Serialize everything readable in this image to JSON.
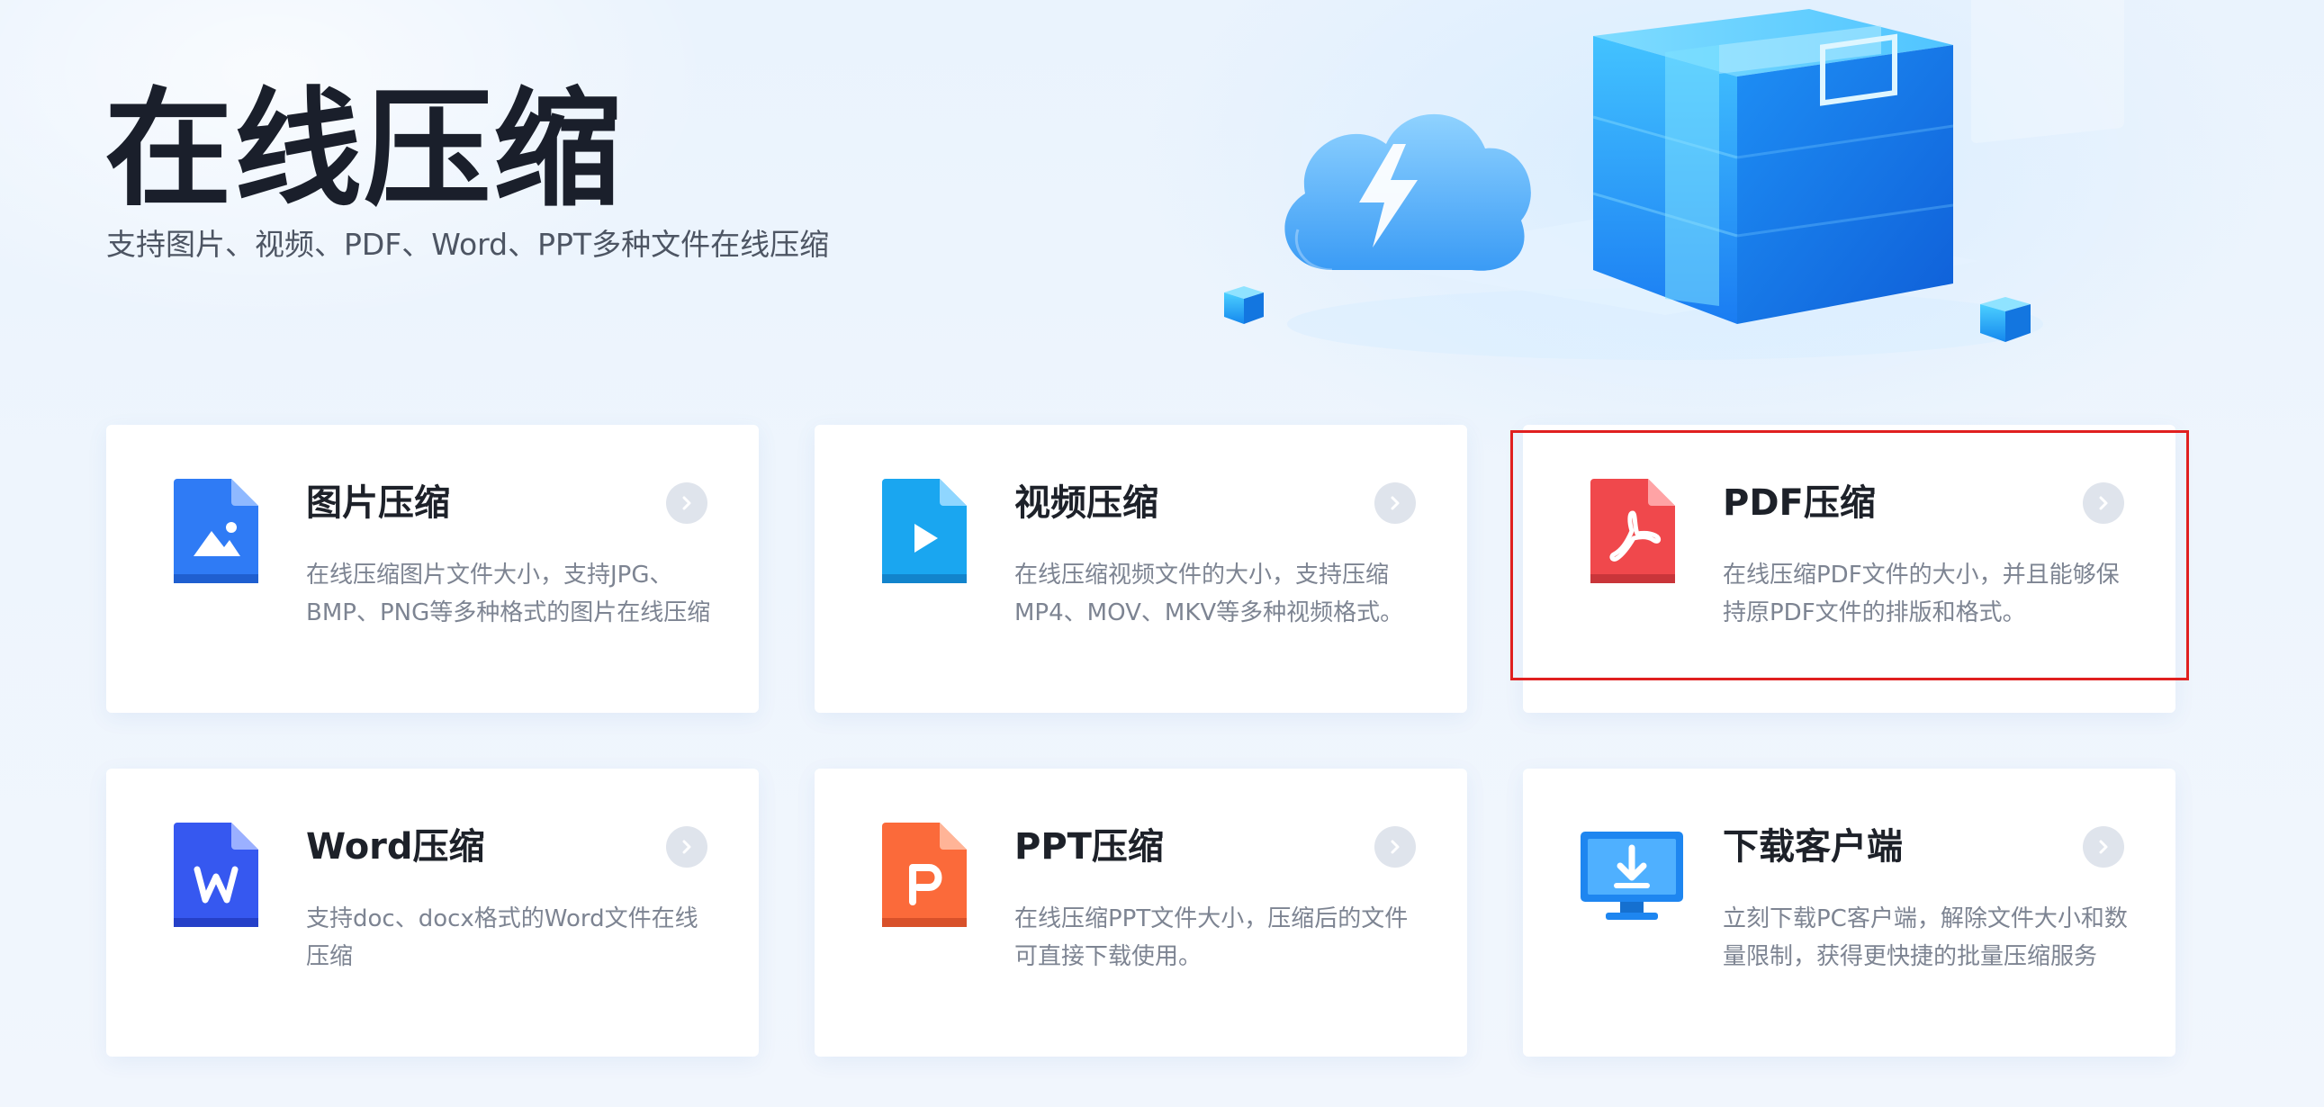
{
  "hero": {
    "title": "在线压缩",
    "subtitle": "支持图片、视频、PDF、Word、PPT多种文件在线压缩"
  },
  "cards": [
    {
      "title": "图片压缩",
      "desc": "在线压缩图片文件大小，支持JPG、BMP、PNG等多种格式的图片在线压缩",
      "icon": "image-file-icon",
      "color": "#2f7bf5"
    },
    {
      "title": "视频压缩",
      "desc": "在线压缩视频文件的大小，支持压缩MP4、MOV、MKV等多种视频格式。",
      "icon": "video-file-icon",
      "color": "#1aa6f0"
    },
    {
      "title": "PDF压缩",
      "desc": "在线压缩PDF文件的大小，并且能够保持原PDF文件的排版和格式。",
      "icon": "pdf-file-icon",
      "color": "#f0484c"
    },
    {
      "title": "Word压缩",
      "desc": "支持doc、docx格式的Word文件在线压缩",
      "icon": "word-file-icon",
      "color": "#3658f0"
    },
    {
      "title": "PPT压缩",
      "desc": "在线压缩PPT文件大小，压缩后的文件可直接下载使用。",
      "icon": "ppt-file-icon",
      "color": "#fb6a3a"
    },
    {
      "title": "下载客户端",
      "desc": "立刻下载PC客户端，解除文件大小和数量限制，获得更快捷的批量压缩服务",
      "icon": "monitor-download-icon",
      "color": "#1e86f0"
    }
  ],
  "colors": {
    "highlight": "#e02020",
    "arrow_bg": "#dfe4ec",
    "title_text": "#1d2129",
    "desc_text": "#7d8492"
  }
}
